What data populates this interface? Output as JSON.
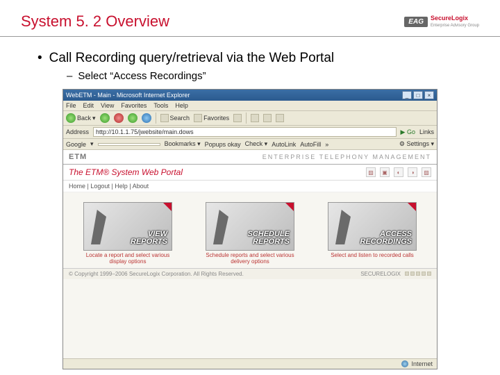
{
  "slide": {
    "title": "System 5. 2 Overview",
    "brand": {
      "badge": "EAG",
      "main": "SecureLogix",
      "sub": "Enterprise Advisory Group"
    },
    "bullet1": "Call Recording query/retrieval via the Web Portal",
    "bullet2": "Select “Access Recordings”"
  },
  "browser": {
    "title": "WebETM - Main - Microsoft Internet Explorer",
    "menus": [
      "File",
      "Edit",
      "View",
      "Favorites",
      "Tools",
      "Help"
    ],
    "back": "Back",
    "search": "Search",
    "favorites": "Favorites",
    "address_label": "Address",
    "address_value": "http://10.1.1.75/jwebsite/main.dows",
    "go": "Go",
    "links": "Links",
    "google_label": "Google",
    "google_items": [
      "Bookmarks",
      "Popups okay",
      "Check",
      "AutoLink",
      "AutoFill"
    ],
    "settings": "Settings",
    "status": "Internet"
  },
  "portal": {
    "logo": "ETM",
    "caption": "ENTERPRISE TELEPHONY MANAGEMENT",
    "title": "The ETM® System Web Portal",
    "nav": "Home | Logout | Help | About",
    "cards": [
      {
        "label_a": "VIEW",
        "label_b": "REPORTS",
        "caption": "Locate a report and select various display options"
      },
      {
        "label_a": "SCHEDULE",
        "label_b": "REPORTS",
        "caption": "Schedule reports and select various delivery options"
      },
      {
        "label_a": "ACCESS",
        "label_b": "RECORDINGS",
        "caption": "Select and listen to recorded calls"
      }
    ],
    "copyright": "© Copyright 1999–2006 SecureLogix Corporation. All Rights Reserved.",
    "footer_brand": "SECURELOGIX"
  }
}
